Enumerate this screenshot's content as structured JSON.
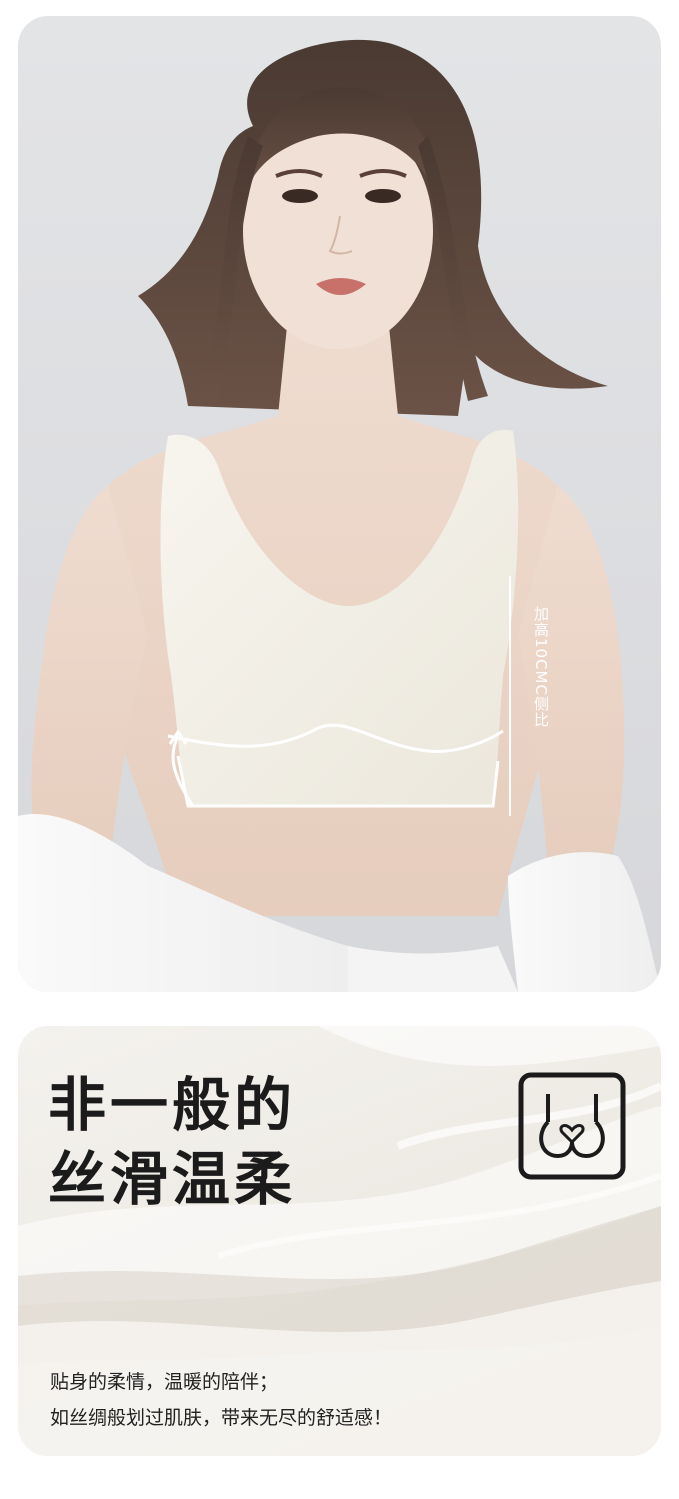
{
  "photo": {
    "side_label": "加高10CMC侧比"
  },
  "feature": {
    "headline_line1": "非一般的",
    "headline_line2": "丝滑温柔",
    "icon": "bra-heart-icon",
    "body_line1": "贴身的柔情，温暖的陪伴；",
    "body_line2": "如丝绸般划过肌肤，带来无尽的舒适感！"
  },
  "colors": {
    "headline": "#1b1b1b",
    "fabric": "#f2f0e9",
    "background": "#e3e4e6"
  }
}
